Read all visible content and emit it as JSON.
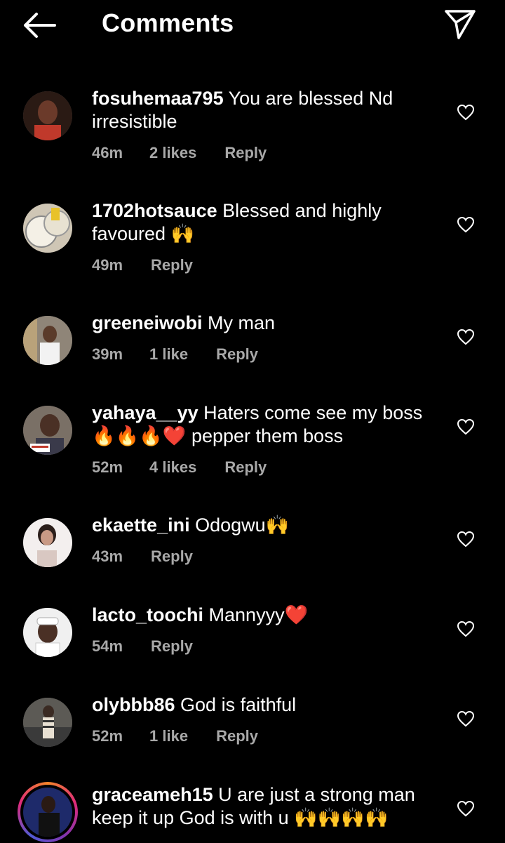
{
  "header": {
    "title": "Comments",
    "back_icon": "arrow-left-icon",
    "send_icon": "paper-plane-icon"
  },
  "comments": [
    {
      "username": "fosuhemaa795",
      "text": " You are blessed Nd irresistible",
      "time": "46m",
      "likes": "2 likes",
      "reply": "Reply",
      "avatar_color": "#6b3a2a"
    },
    {
      "username": "1702hotsauce",
      "text": " Blessed and highly favoured 🙌",
      "time": "49m",
      "likes": "",
      "reply": "Reply",
      "avatar_color": "#d8d0c0"
    },
    {
      "username": "greeneiwobi",
      "text": " My man",
      "time": "39m",
      "likes": "1 like",
      "reply": "Reply",
      "avatar_color": "#9a8f86"
    },
    {
      "username": "yahaya__yy",
      "text": " Haters come see my boss 🔥🔥🔥❤️ pepper them boss",
      "time": "52m",
      "likes": "4 likes",
      "reply": "Reply",
      "avatar_color": "#4a3b32"
    },
    {
      "username": "ekaette_ini",
      "text": " Odogwu🙌",
      "time": "43m",
      "likes": "",
      "reply": "Reply",
      "avatar_color": "#d9c8c2"
    },
    {
      "username": "lacto_toochi",
      "text": " Mannyyy❤️",
      "time": "54m",
      "likes": "",
      "reply": "Reply",
      "avatar_color": "#e5e5e5"
    },
    {
      "username": "olybbb86",
      "text": " God is faithful",
      "time": "52m",
      "likes": "1 like",
      "reply": "Reply",
      "avatar_color": "#6e6a60"
    },
    {
      "username": "graceameh15",
      "text": " U are just a strong man keep it up God is with u 🙌🙌🙌🙌",
      "time": "",
      "likes": "",
      "reply": "",
      "avatar_color": "#2a2f6a"
    }
  ],
  "colors": {
    "background": "#000000",
    "text": "#ffffff",
    "meta": "#a8a8a8"
  }
}
